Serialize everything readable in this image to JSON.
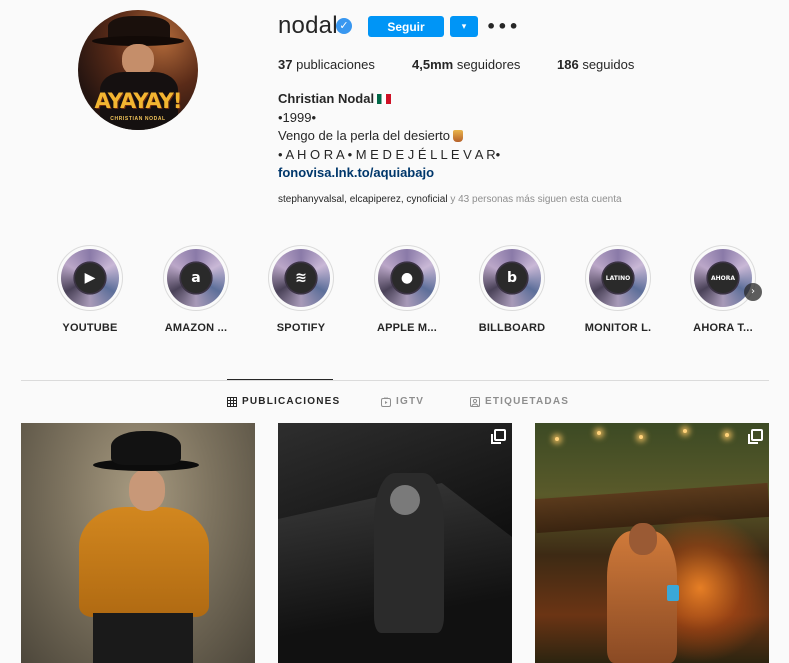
{
  "profile": {
    "username": "nodal",
    "follow_label": "Seguir",
    "dropdown_glyph": "▾",
    "more_glyph": "•••",
    "verified_glyph": "✓",
    "avatar": {
      "title": "AYAYAY!",
      "subtitle": "CHRISTIAN NODAL"
    },
    "stats": {
      "posts_count": "37",
      "posts_label": "publicaciones",
      "followers_count": "4,5mm",
      "followers_label": "seguidores",
      "following_count": "186",
      "following_label": "seguidos"
    },
    "bio": {
      "name": "Christian Nodal",
      "line1": "•1999•",
      "line2": "Vengo de la perla del desierto",
      "line3": "• A H O R A • M E D E J É L L E V A R•",
      "link": "fonovisa.lnk.to/aquiabajo"
    },
    "followed_by": {
      "accounts": "stephanyvalsal, elcapiperez, cynoficial",
      "suffix": " y 43 personas más siguen esta cuenta"
    }
  },
  "highlights": [
    {
      "label": "YOUTUBE",
      "icon": "youtube-icon",
      "glyph": "▶"
    },
    {
      "label": "AMAZON ...",
      "icon": "amazon-icon",
      "glyph": "a"
    },
    {
      "label": "SPOTIFY",
      "icon": "spotify-icon",
      "glyph": "≋"
    },
    {
      "label": "APPLE M...",
      "icon": "apple-icon",
      "glyph": "●"
    },
    {
      "label": "BILLBOARD",
      "icon": "billboard-icon",
      "glyph": "b"
    },
    {
      "label": "MONITOR L.",
      "icon": "monitor-latino-icon",
      "glyph": "LATINO"
    },
    {
      "label": "AHORA T...",
      "icon": "ahora-icon",
      "glyph": "AHORA"
    }
  ],
  "highlights_next_glyph": "›",
  "tabs": [
    {
      "label": "PUBLICACIONES",
      "icon": "grid-icon",
      "active": true
    },
    {
      "label": "IGTV",
      "icon": "igtv-icon",
      "active": false
    },
    {
      "label": "ETIQUETADAS",
      "icon": "tagged-icon",
      "active": false
    }
  ],
  "posts": [
    {
      "type": "photo"
    },
    {
      "type": "carousel"
    },
    {
      "type": "carousel"
    }
  ],
  "colors": {
    "accent": "#0095f6",
    "link": "#00376b",
    "muted": "#8e8e8e",
    "text": "#262626",
    "background": "#fafafa"
  }
}
